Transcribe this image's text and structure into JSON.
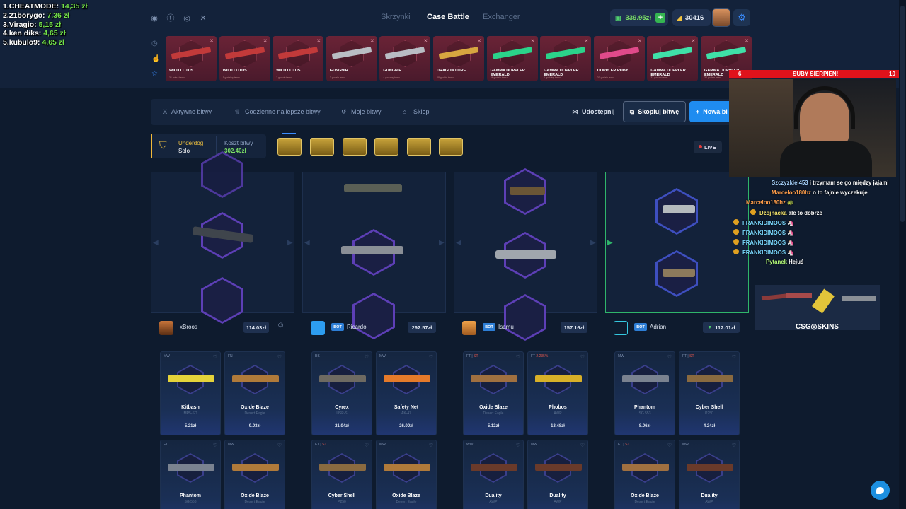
{
  "leaderboard": [
    {
      "rank": "1.CHEATMODE:",
      "amount": "14,35 zł"
    },
    {
      "rank": "2.21borygo:",
      "amount": "7,36 zł"
    },
    {
      "rank": "3.Viragio:",
      "amount": "5,15 zł"
    },
    {
      "rank": "4.ken diks:",
      "amount": "4,65 zł"
    },
    {
      "rank": "5.kubulo9:",
      "amount": "4,65 zł"
    }
  ],
  "social_icons": [
    "discord-icon",
    "facebook-icon",
    "instagram-icon",
    "x-icon"
  ],
  "nav": {
    "tab1": "Skrzynki",
    "tab2": "Case Battle",
    "tab3": "Exchanger"
  },
  "wallet": {
    "balance": "339.95zł",
    "coins": "30416"
  },
  "drops": [
    {
      "name": "WILD LOTUS",
      "time": "31 minut temu"
    },
    {
      "name": "WILD LOTUS",
      "time": "1 godzinę temu"
    },
    {
      "name": "WILD LOTUS",
      "time": "2 godzin temu"
    },
    {
      "name": "GUNGNIR",
      "time": "2 godzin temu"
    },
    {
      "name": "GUNGNIR",
      "time": "4 godziny temu"
    },
    {
      "name": "DRAGON LORE",
      "time": "28 godzin temu"
    },
    {
      "name": "GAMMA DOPPLER EMERALD",
      "time": "34 godzin temu"
    },
    {
      "name": "GAMMA DOPPLER EMERALD",
      "time": "1 godziny temu"
    },
    {
      "name": "DOPPLER RUBY",
      "time": "20 godzin temu"
    },
    {
      "name": "GAMMA DOPPLER EMERALD",
      "time": "31 godzin temu"
    },
    {
      "name": "GAMMA DOPPLER EMERALD",
      "time": "32 godzin temu"
    }
  ],
  "tabs": {
    "active": "Aktywne bitwy",
    "best": "Codzienne najlepsze bitwy",
    "mine": "Moje bitwy",
    "shop": "Sklep",
    "share": "Udostępnij",
    "copy": "Skopiuj bitwę",
    "new": "Nowa bi"
  },
  "battle": {
    "mode": "Underdog",
    "type": "Solo",
    "cost_label": "Koszt bitwy",
    "cost": "302.40zł",
    "live": "LIVE"
  },
  "players": [
    {
      "name": "xBroos",
      "amount": "114.03zł",
      "bot": false
    },
    {
      "name": "Ricardo",
      "amount": "292.57zł",
      "bot": true
    },
    {
      "name": "Isamu",
      "amount": "157.16zł",
      "bot": true
    },
    {
      "name": "Adrian",
      "amount": "112.01zł",
      "bot": true
    }
  ],
  "bot_label": "BOT",
  "items": [
    {
      "q": "MW",
      "st": "",
      "name": "Kitbash",
      "sub": "MP5-SD",
      "price": "5.21zł"
    },
    {
      "q": "FN",
      "st": "",
      "name": "Oxide Blaze",
      "sub": "Desert Eagle",
      "price": "9.03zł"
    },
    {
      "q": "BS",
      "st": "",
      "name": "Cyrex",
      "sub": "USP-S",
      "price": "21.04zł"
    },
    {
      "q": "MW",
      "st": "",
      "name": "Safety Net",
      "sub": "AK-47",
      "price": "26.00zł"
    },
    {
      "q": "FT |",
      "st": "ST",
      "name": "Oxide Blaze",
      "sub": "Desert Eagle",
      "price": "5.12zł"
    },
    {
      "q": "FT",
      "st": "2.235%",
      "name": "Phobos",
      "sub": "AWP",
      "price": "13.48zł"
    },
    {
      "q": "MW",
      "st": "",
      "name": "Phantom",
      "sub": "SG 553",
      "price": "8.06zł"
    },
    {
      "q": "FT |",
      "st": "ST",
      "name": "Cyber Shell",
      "sub": "P250",
      "price": "4.24zł"
    },
    {
      "q": "FT",
      "st": "",
      "name": "Phantom",
      "sub": "SG 553",
      "price": ""
    },
    {
      "q": "MW",
      "st": "",
      "name": "Oxide Blaze",
      "sub": "Desert Eagle",
      "price": ""
    },
    {
      "q": "FT |",
      "st": "ST",
      "name": "Cyber Shell",
      "sub": "P250",
      "price": ""
    },
    {
      "q": "MW",
      "st": "",
      "name": "Oxide Blaze",
      "sub": "Desert Eagle",
      "price": ""
    },
    {
      "q": "WW",
      "st": "",
      "name": "Duality",
      "sub": "AWP",
      "price": ""
    },
    {
      "q": "MW",
      "st": "",
      "name": "Duality",
      "sub": "AWP",
      "price": ""
    },
    {
      "q": "FT |",
      "st": "ST",
      "name": "Oxide Blaze",
      "sub": "Desert Eagle",
      "price": ""
    },
    {
      "q": "MW",
      "st": "",
      "name": "Duality",
      "sub": "AWP",
      "price": ""
    }
  ],
  "stream": {
    "goal_left": "6",
    "goal_title": "SUBY SIERPIEŃ!",
    "goal_right": "10",
    "chat": [
      {
        "user": "Szczyzkiel453",
        "msg": "i trzymam se go między jajami",
        "color": "#a8d4ff"
      },
      {
        "user": "Marceloo180hz",
        "msg": "o to fajnie wyczekuje",
        "color": "#ff9d4a"
      },
      {
        "user": "Marceloo180hz",
        "msg": "🐢",
        "color": "#ff9d4a"
      },
      {
        "user": "Dzojnacka",
        "msg": "ale to dobrze",
        "color": "#f0e06a"
      },
      {
        "user": "FRANKIDIMOOS",
        "msg": "🦄",
        "color": "#7ad8ff"
      },
      {
        "user": "FRANKIDIMOOS",
        "msg": "🦄",
        "color": "#7ad8ff"
      },
      {
        "user": "FRANKIDIMOOS",
        "msg": "🦄",
        "color": "#7ad8ff"
      },
      {
        "user": "FRANKIDIMOOS",
        "msg": "🦄",
        "color": "#7ad8ff"
      },
      {
        "user": "Pytanek",
        "msg": "Hejuś",
        "color": "#b6ff7a"
      }
    ],
    "sponsor": "CSG◎SKINS"
  }
}
